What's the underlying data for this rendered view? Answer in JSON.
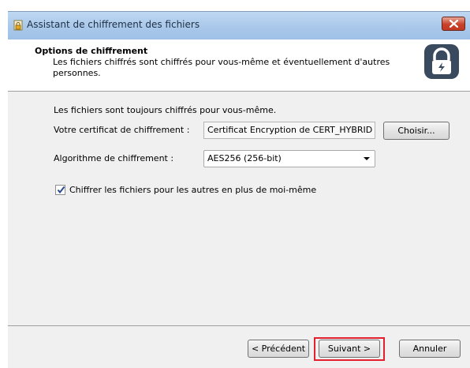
{
  "window": {
    "title": "Assistant de chiffrement des fichiers"
  },
  "header": {
    "title": "Options de chiffrement",
    "description": "Les fichiers chiffrés sont chiffrés pour vous-même et éventuellement d'autres personnes."
  },
  "body": {
    "intro": "Les fichiers sont toujours chiffrés pour vous-même.",
    "certificate_label": "Votre certificat de chiffrement :",
    "certificate_value": "Certificat Encryption de CERT_HYBRID",
    "choose_button": "Choisir...",
    "algorithm_label": "Algorithme de chiffrement :",
    "algorithm_selected": "AES256 (256-bit)",
    "encrypt_others_checkbox": {
      "label": "Chiffrer les fichiers pour les autres en plus de moi-même",
      "checked": true
    }
  },
  "footer": {
    "back_button": "< Précédent",
    "next_button": "Suivant >",
    "cancel_button": "Annuler"
  },
  "colors": {
    "highlight": "#e2202e",
    "titlebar": "#a9c8ea",
    "close_button": "#c8412a",
    "lock_icon": "#3a4a5e"
  },
  "icons": {
    "app": "lock-file-icon",
    "close": "close-icon",
    "header": "lock-icon",
    "checkbox": "checkmark-icon"
  }
}
